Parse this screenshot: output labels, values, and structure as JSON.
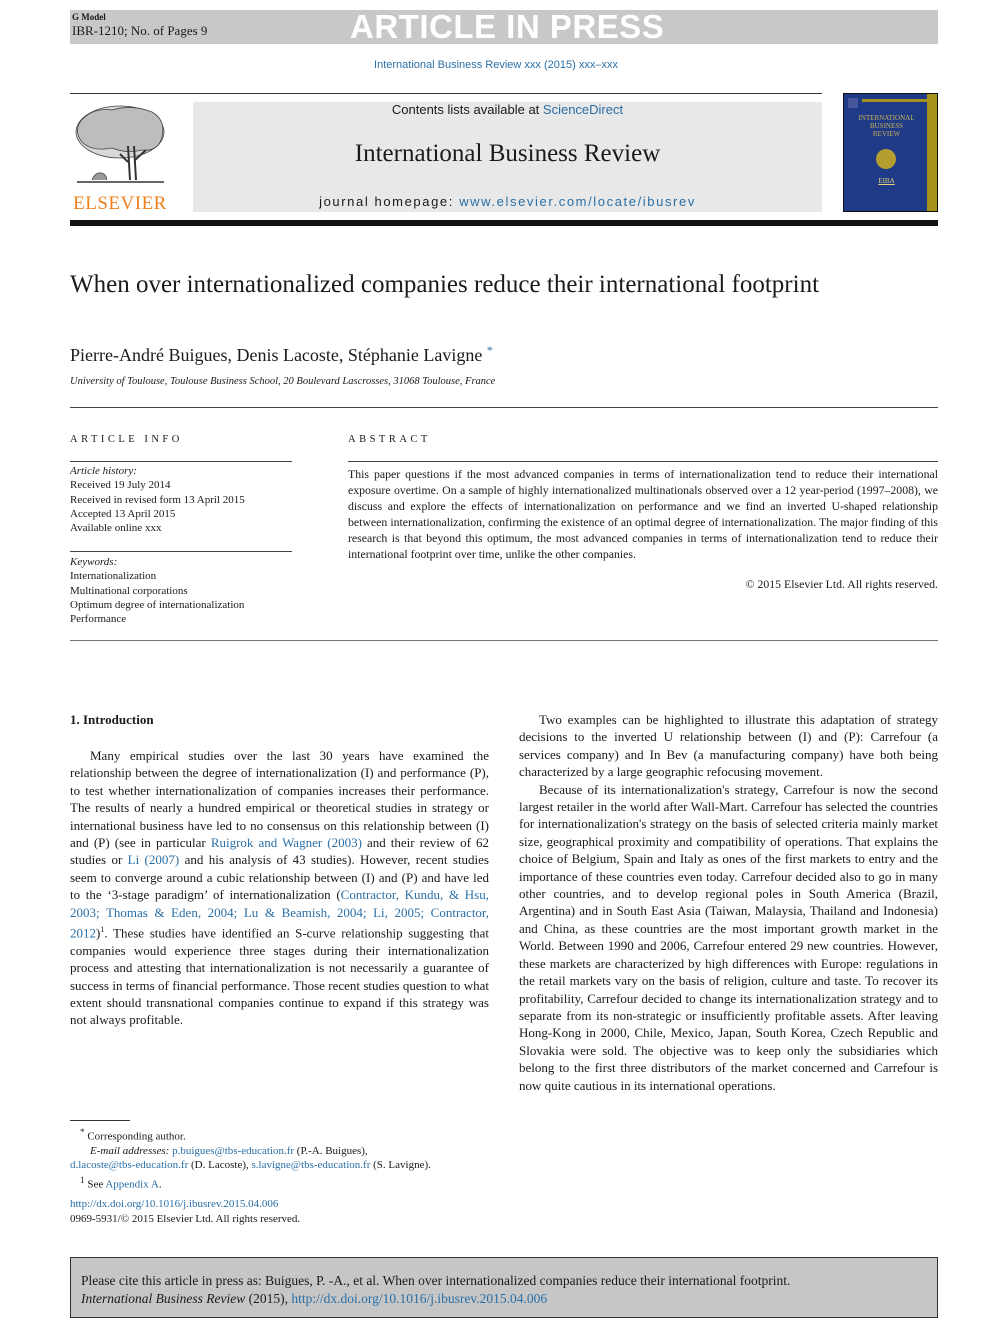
{
  "banner": {
    "g_model": "G Model",
    "article_id_pages": "IBR-1210; No. of Pages 9",
    "status": "ARTICLE IN PRESS"
  },
  "journal_ref": "International Business Review xxx (2015) xxx–xxx",
  "masthead": {
    "publisher": "ELSEVIER",
    "contents_prefix": "Contents lists available at ",
    "contents_link": "ScienceDirect",
    "journal_name": "International Business Review",
    "homepage_label": "journal homepage: ",
    "homepage_url": "www.elsevier.com/locate/ibusrev",
    "cover": {
      "title_lines": [
        "INTERNATIONAL",
        "BUSINESS",
        "REVIEW"
      ],
      "badge": "EIBA"
    },
    "colors": {
      "publisher_orange": "#f07f1e",
      "cover_blue": "#1f3a86",
      "cover_gold": "#a5911c",
      "link_blue": "#2a6fa6"
    }
  },
  "article": {
    "title": "When over internationalized companies reduce their international footprint",
    "authors": "Pierre-André Buigues, Denis Lacoste, Stéphanie Lavigne",
    "author_mark": "*",
    "affiliation": "University of Toulouse, Toulouse Business School, 20 Boulevard Lascrosses, 31068 Toulouse, France"
  },
  "article_info": {
    "heading": "ARTICLE INFO",
    "history_label": "Article history:",
    "history": [
      "Received 19 July 2014",
      "Received in revised form 13 April 2015",
      "Accepted 13 April 2015",
      "Available online xxx"
    ],
    "keywords_label": "Keywords:",
    "keywords": [
      "Internationalization",
      "Multinational corporations",
      "Optimum degree of internationalization",
      "Performance"
    ]
  },
  "abstract": {
    "heading": "ABSTRACT",
    "text": "This paper questions if the most advanced companies in terms of internationalization tend to reduce their international exposure overtime. On a sample of highly internationalized multinationals observed over a 12 year-period (1997–2008), we discuss and explore the effects of internationalization on performance and we find an inverted U-shaped relationship between internationalization, confirming the existence of an optimal degree of internationalization. The major finding of this research is that beyond this optimum, the most advanced companies in terms of internationalization tend to reduce their international footprint over time, unlike the other companies.",
    "copyright": "© 2015 Elsevier Ltd. All rights reserved."
  },
  "body": {
    "section_heading": "1.  Introduction",
    "left_p1_a": "Many empirical studies over the last 30 years have examined the relationship between the degree of internationalization (I) and performance (P), to test whether internationalization of companies increases their performance. The results of nearly a hundred empirical or theoretical studies in strategy or international business have led to no consensus on this relationship between (I) and (P) (see in particular ",
    "left_p1_link1": "Ruigrok and Wagner (2003)",
    "left_p1_b": " and their review of 62 studies or ",
    "left_p1_link2": "Li (2007)",
    "left_p1_c": " and his analysis of 43 studies). However, recent studies seem to converge around a cubic relationship between (I) and (P) and have led to the ‘3-stage paradigm’ of internationalization (",
    "left_p1_link3": "Contractor, Kundu, & Hsu, 2003; Thomas & Eden, 2004; Lu & Beamish, 2004; Li, 2005; Contractor, 2012",
    "left_p1_d": ")",
    "left_p1_sup": "1",
    "left_p1_e": ". These studies have identified an S-curve relationship suggesting that companies would experience three stages during their internationalization process and attesting that internationalization is not necessarily a guarantee of success in terms of financial performance. Those recent studies question to what extent should transnational companies continue to expand if this strategy was not always profitable.",
    "right_p1": "Two examples can be highlighted to illustrate this adaptation of strategy decisions to the inverted U relationship between (I) and (P): Carrefour (a services company) and In Bev (a manufacturing company) have both being characterized by a large geographic refocusing movement.",
    "right_p2": "Because of its internationalization's strategy, Carrefour is now the second largest retailer in the world after Wall-Mart. Carrefour has selected the countries for internationalization's strategy on the basis of selected criteria mainly market size, geographical proximity and compatibility of operations. That explains the choice of Belgium, Spain and Italy as ones of the first markets to entry and the importance of these countries even today. Carrefour decided also to go in many other countries, and to develop regional poles in South America (Brazil, Argentina) and in South East Asia (Taiwan, Malaysia, Thailand and Indonesia) and China, as these countries are the most important growth market in the World. Between 1990 and 2006, Carrefour entered 29 new countries. However, these markets are characterized by high differences with Europe: regulations in the retail markets vary on the basis of religion, culture and taste. To recover its profitability, Carrefour decided to change its internationalization strategy and to separate from its non-strategic or insufficiently profitable assets. After leaving Hong-Kong in 2000, Chile, Mexico, Japan, South Korea, Czech Republic and Slovakia were sold. The objective was to keep only the subsidiaries which belong to the first three distributors of the market concerned and Carrefour is now quite cautious in its international operations."
  },
  "footnotes": {
    "star": "*",
    "corresponding": "Corresponding author.",
    "email_label": "E-mail addresses: ",
    "email1": "p.buigues@tbs-education.fr",
    "email1_name": " (P.-A. Buigues),",
    "email2": "d.lacoste@tbs-education.fr",
    "email2_name": " (D. Lacoste), ",
    "email3": "s.lavigne@tbs-education.fr",
    "email3_name": " (S. Lavigne).",
    "fn1_mark": "1",
    "fn1_text": " See ",
    "fn1_link": "Appendix A",
    "fn1_end": ".",
    "doi": "http://dx.doi.org/10.1016/j.ibusrev.2015.04.006",
    "issn_copyright": "0969-5931/© 2015 Elsevier Ltd. All rights reserved."
  },
  "citation": {
    "line1": "Please cite this article in press as: Buigues, P. -A., et al. When over internationalized companies reduce their international footprint.",
    "journal": "International Business Review",
    "year": " (2015), ",
    "doi": "http://dx.doi.org/10.1016/j.ibusrev.2015.04.006"
  }
}
